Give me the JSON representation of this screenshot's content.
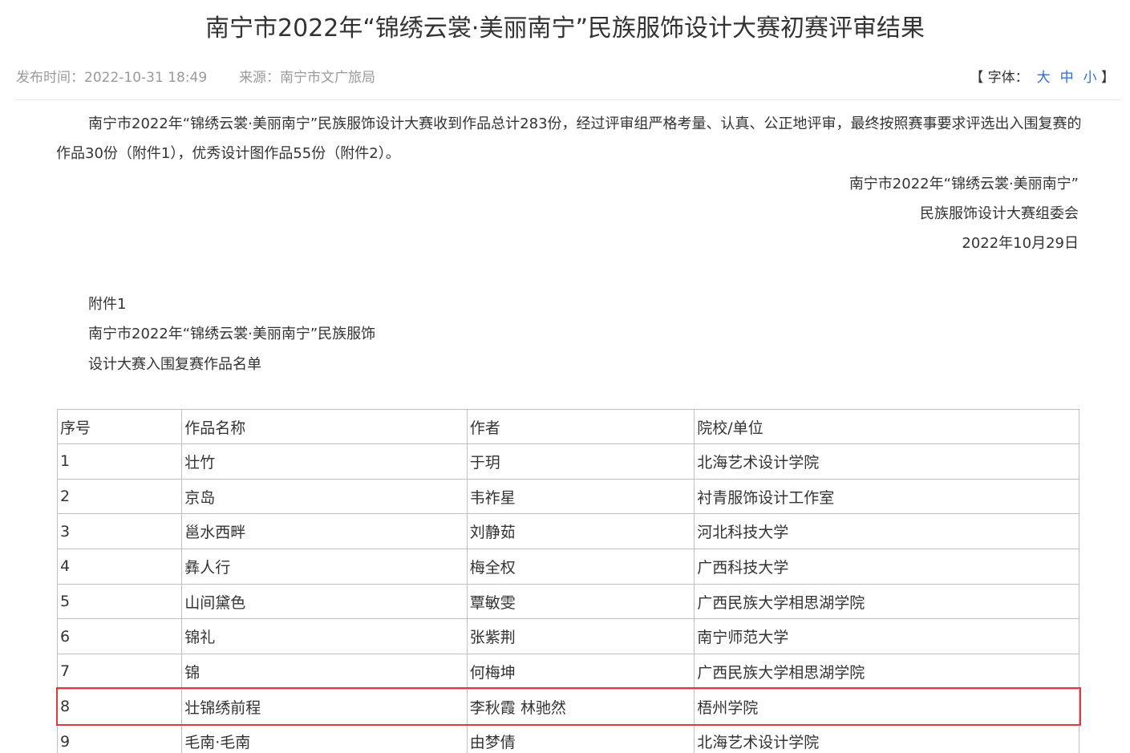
{
  "article": {
    "title": "南宁市2022年“锦绣云裳·美丽南宁”民族服饰设计大赛初赛评审结果",
    "published": "发布时间：2022-10-31 18:49",
    "source": "来源：南宁市文广旅局",
    "font_control": {
      "open_bracket": "【 字体：",
      "large": "大",
      "medium": "中",
      "small": "小",
      "close_bracket": " 】"
    },
    "intro": "南宁市2022年“锦绣云裳·美丽南宁”民族服饰设计大赛收到作品总计283份，经过评审组严格考量、认真、公正地评审，最终按照赛事要求评选出入围复赛的作品30份（附件1），优秀设计图作品55份（附件2）。",
    "signature": {
      "line1": "南宁市2022年“锦绣云裳·美丽南宁”",
      "line2": "民族服饰设计大赛组委会",
      "date": "2022年10月29日"
    },
    "annex": {
      "label": "附件1",
      "title_line1": "南宁市2022年“锦绣云裳·美丽南宁”民族服饰",
      "title_line2": "设计大赛入围复赛作品名单"
    },
    "table": {
      "headers": [
        "序号",
        "作品名称",
        "作者",
        "院校/单位"
      ],
      "rows": [
        [
          "1",
          "壮竹",
          "于玥",
          "北海艺术设计学院"
        ],
        [
          "2",
          "京岛",
          "韦祚星",
          "衬青服饰设计工作室"
        ],
        [
          "3",
          "邕水西畔",
          "刘静茹",
          "河北科技大学"
        ],
        [
          "4",
          "彝人行",
          "梅全权",
          "广西科技大学"
        ],
        [
          "5",
          "山间黛色",
          "覃敏雯",
          "广西民族大学相思湖学院"
        ],
        [
          "6",
          "锦礼",
          "张紫荆",
          "南宁师范大学"
        ],
        [
          "7",
          "锦",
          "何梅坤",
          "广西民族大学相思湖学院"
        ],
        [
          "8",
          "壮锦绣前程",
          "李秋霞 林驰然",
          "梧州学院"
        ],
        [
          "9",
          "毛南·毛南",
          "由梦倩",
          "北海艺术设计学院"
        ]
      ]
    },
    "highlight_color": "#e0393e",
    "link_color": "#2f6ed1"
  }
}
